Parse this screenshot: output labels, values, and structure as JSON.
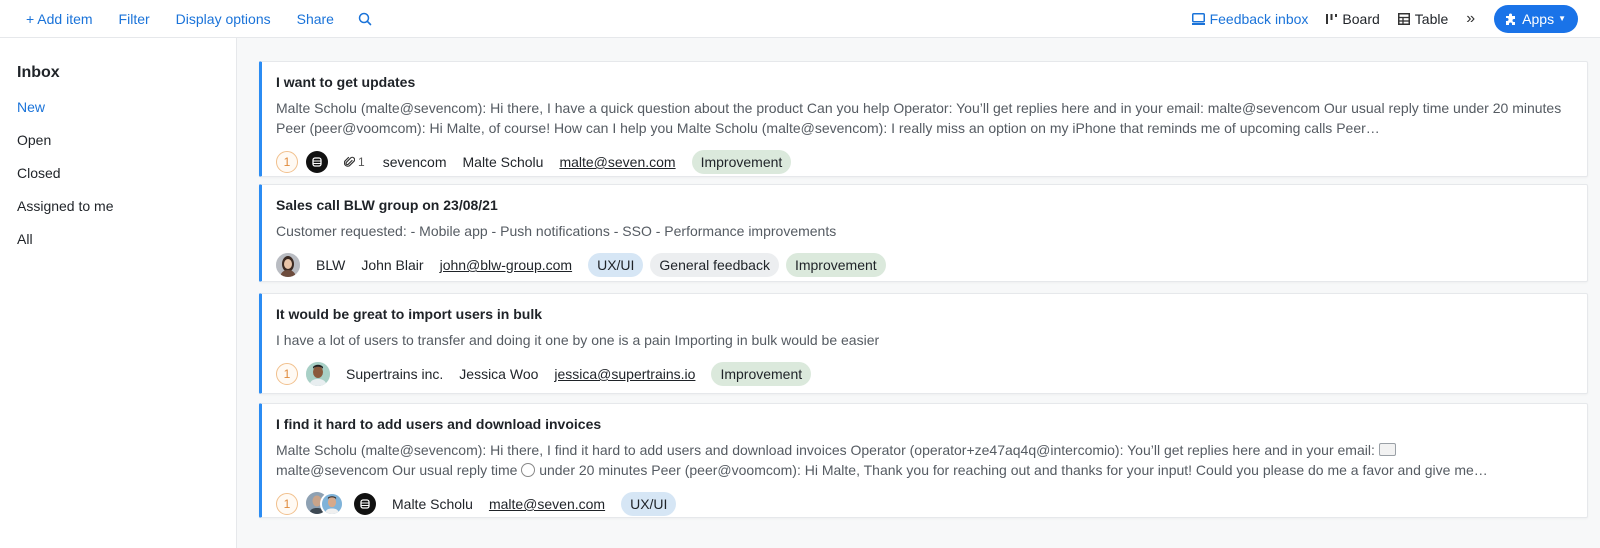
{
  "toolbar": {
    "add_item": "+ Add item",
    "filter": "Filter",
    "display_options": "Display options",
    "share": "Share",
    "feedback_inbox": "Feedback inbox",
    "board": "Board",
    "table": "Table",
    "more": "»",
    "apps": "Apps",
    "apps_caret": "▼"
  },
  "sidebar": {
    "title": "Inbox",
    "items": [
      {
        "label": "New"
      },
      {
        "label": "Open"
      },
      {
        "label": "Closed"
      },
      {
        "label": "Assigned to me"
      },
      {
        "label": "All"
      }
    ]
  },
  "cards": [
    {
      "title": "I want to get updates",
      "body": "Malte Scholu (malte@sevencom): Hi there, I have a quick question about the product Can you help Operator: You’ll get replies here and in your email: malte@sevencom Our usual reply time under 20 minutes Peer (peer@voomcom): Hi Malte, of course! How can I help you Malte Scholu (malte@sevencom): I really miss an option on my iPhone that reminds me of upcoming calls Peer…",
      "count": "1",
      "attachments": "1",
      "company": "sevencom",
      "person": "Malte Scholu",
      "email": "malte@seven.com",
      "tags": [
        "Improvement"
      ]
    },
    {
      "title": "Sales call BLW group on 23/08/21",
      "body": "Customer requested: - Mobile app - Push notifications - SSO - Performance improvements",
      "company": "BLW",
      "person": "John Blair",
      "email": "john@blw-group.com",
      "tags": [
        "UX/UI",
        "General feedback",
        "Improvement"
      ]
    },
    {
      "title": "It would be great to import users in bulk",
      "body": "I have a lot of users to transfer and doing it one by one is a pain Importing in bulk would be easier",
      "count": "1",
      "company": "Supertrains inc.",
      "person": "Jessica Woo",
      "email": "jessica@supertrains.io",
      "tags": [
        "Improvement"
      ]
    },
    {
      "title": "I find it hard to add users and download invoices",
      "body_part1": "Malte Scholu (malte@sevencom): Hi there, I find it hard to add users and download invoices Operator (operator+ze47aq4q@intercomio): You’ll get replies here and in your email:",
      "body_part2": "malte@sevencom Our usual reply time",
      "body_part3": "under 20 minutes Peer (peer@voomcom): Hi Malte, Thank you for reaching out and thanks for your input! Could you please do me a favor and give me…",
      "count": "1",
      "person": "Malte Scholu",
      "email": "malte@seven.com",
      "tags": [
        "UX/UI"
      ]
    }
  ],
  "colors": {
    "accent": "#1a73d9",
    "card_border": "#2b8cf3",
    "tag_green": "#dbe9dc",
    "tag_blue": "#d6e6f5",
    "tag_gray": "#eceef0"
  }
}
